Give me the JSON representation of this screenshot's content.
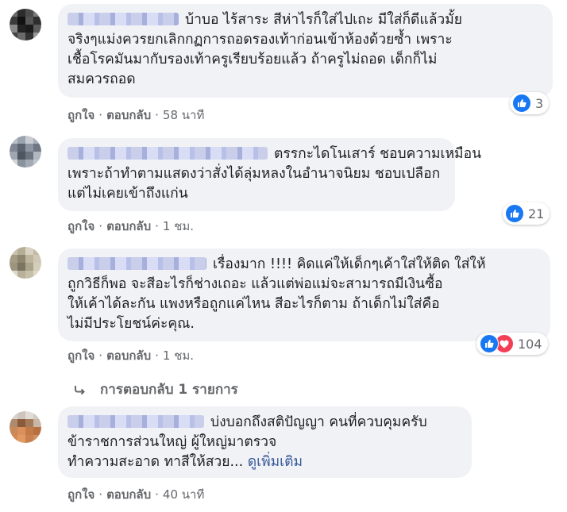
{
  "comments": [
    {
      "lines": [
        "บ้าบอ ไร้สาระ สีห่าไรก็ใส่ไปเถะ มีใส่ก็ดีแล้วมั้ย",
        "จริงๆแม่งควรยกเลิกกฏการถอดรองเท้าก่อนเข้าห้องด้วยซ้ำ เพราะ",
        "เชื้อโรคมันมากับรองเท้าครูเรียบร้อยแล้ว ถ้าครูไม่ถอด เด็กก็ไม่",
        "สมควรถอด"
      ],
      "like_label": "ถูกใจ",
      "reply_label": "ตอบกลับ",
      "time": "58 นาที",
      "reaction_count": "3",
      "reactions": [
        "like"
      ]
    },
    {
      "lines": [
        "ตรรกะไดโนเสาร์ ชอบความเหมือน",
        "เพราะถ้าทำตามแสดงว่าสั่งได้ลุ่มหลงในอำนาจนิยม ชอบเปลือก",
        "แต่ไม่เคยเข้าถึงแก่น"
      ],
      "like_label": "ถูกใจ",
      "reply_label": "ตอบกลับ",
      "time": "1 ชม.",
      "reaction_count": "21",
      "reactions": [
        "like"
      ]
    },
    {
      "lines": [
        "เรื่องมาก !!!! คิดแค่ให้เด็กๆเค้าใส่ให้ติด ใส่ให้",
        "ถูกวิธีก็พอ จะสีอะไรก็ช่างเถอะ แล้วแต่พ่อแม่จะสามารถมีเงินซื้อ",
        "ให้เค้าได้ละกัน แพงหรือถูกแค่ไหน สีอะไรก็ตาม ถ้าเด็กไม่ใส่คือ",
        "ไม่มีประโยชน์ค่ะคุณ."
      ],
      "like_label": "ถูกใจ",
      "reply_label": "ตอบกลับ",
      "time": "1 ชม.",
      "reaction_count": "104",
      "reactions": [
        "like",
        "love"
      ]
    },
    {
      "lines": [
        "บ่งบอกถึงสติปัญญา คนที่ควบคุมครับ",
        "ข้าราชการส่วนใหญ่ ผู้ใหญ่มาตรวจ",
        "ทำความสะอาด ทาสีให้สวย..."
      ],
      "see_more": "ดูเพิ่มเติม",
      "like_label": "ถูกใจ",
      "reply_label": "ตอบกลับ",
      "time": "40 นาที"
    }
  ],
  "replies_link": "การตอบกลับ 1 รายการ",
  "colors": {
    "bubble": "#f0f2f5",
    "muted": "#65676b",
    "like": "#1877f2",
    "love": "#f33e58",
    "link": "#385898"
  }
}
